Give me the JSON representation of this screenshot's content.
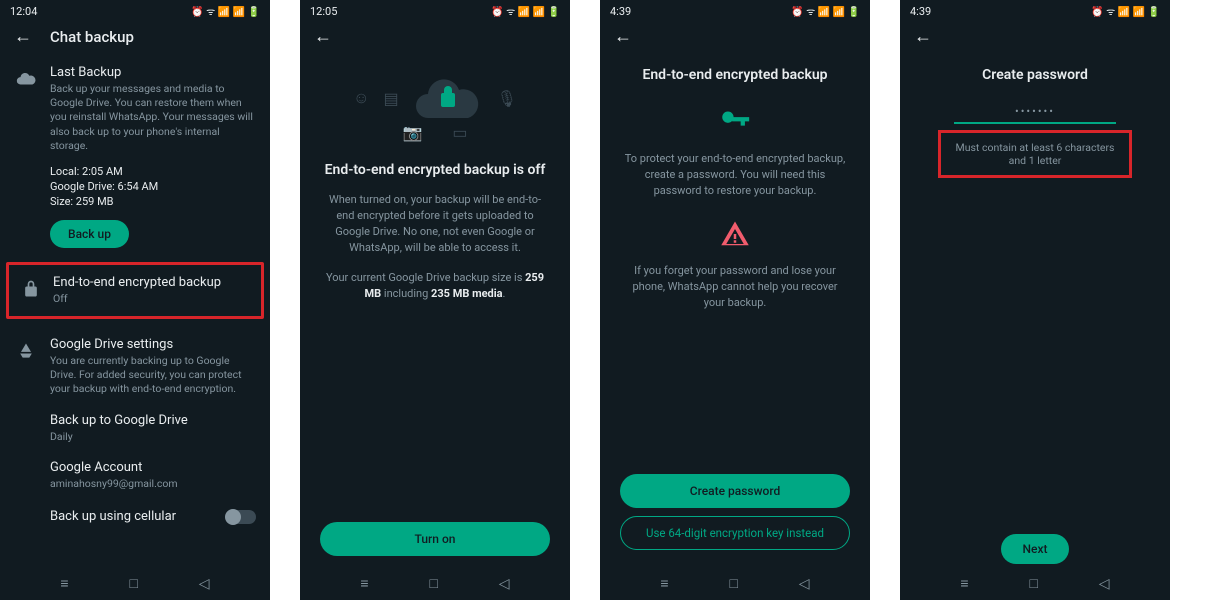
{
  "screens": [
    {
      "status": {
        "time": "12:04",
        "icons": "⏰ ᯤ 📶 📶 🔋"
      },
      "appbar": {
        "title": "Chat backup"
      },
      "last_backup": {
        "title": "Last Backup",
        "desc": "Back up your messages and media to Google Drive. You can restore them when you reinstall WhatsApp. Your messages will also back up to your phone's internal storage.",
        "local": "Local: 2:05 AM",
        "drive": "Google Drive: 6:54 AM",
        "size": "Size: 259 MB",
        "btn": "Back up"
      },
      "e2e": {
        "title": "End-to-end encrypted backup",
        "value": "Off"
      },
      "gdrive": {
        "title": "Google Drive settings",
        "desc": "You are currently backing up to Google Drive. For added security, you can protect your backup with end-to-end encryption.",
        "opt1_title": "Back up to Google Drive",
        "opt1_value": "Daily",
        "opt2_title": "Google Account",
        "opt2_value": "aminahosny99@gmail.com",
        "opt3_title": "Back up using cellular"
      }
    },
    {
      "status": {
        "time": "12:05",
        "icons": "⏰ ᯤ 📶 📶 🔋"
      },
      "title": "End-to-end encrypted backup is off",
      "body1": "When turned on, your backup will be end-to-end encrypted before it gets uploaded to Google Drive. No one, not even Google or WhatsApp, will be able to access it.",
      "body2_pre": "Your current Google Drive backup size is ",
      "body2_b1": "259 MB",
      "body2_mid": " including ",
      "body2_b2": "235 MB media",
      "body2_post": ".",
      "btn": "Turn on"
    },
    {
      "status": {
        "time": "4:39",
        "icons": "⏰ ᯤ 📶 📶 🔋"
      },
      "title": "End-to-end encrypted backup",
      "body1": "To protect your end-to-end encrypted backup, create a password. You will need this password to restore your backup.",
      "body2": "If you forget your password and lose your phone, WhatsApp cannot help you recover your backup.",
      "btn1": "Create password",
      "btn2": "Use 64-digit encryption key instead"
    },
    {
      "status": {
        "time": "4:39",
        "icons": "⏰ ᯤ 📶 📶 🔋"
      },
      "title": "Create password",
      "pw_mask": "•••••••",
      "hint": "Must contain at least 6 characters and 1 letter",
      "btn": "Next"
    }
  ]
}
